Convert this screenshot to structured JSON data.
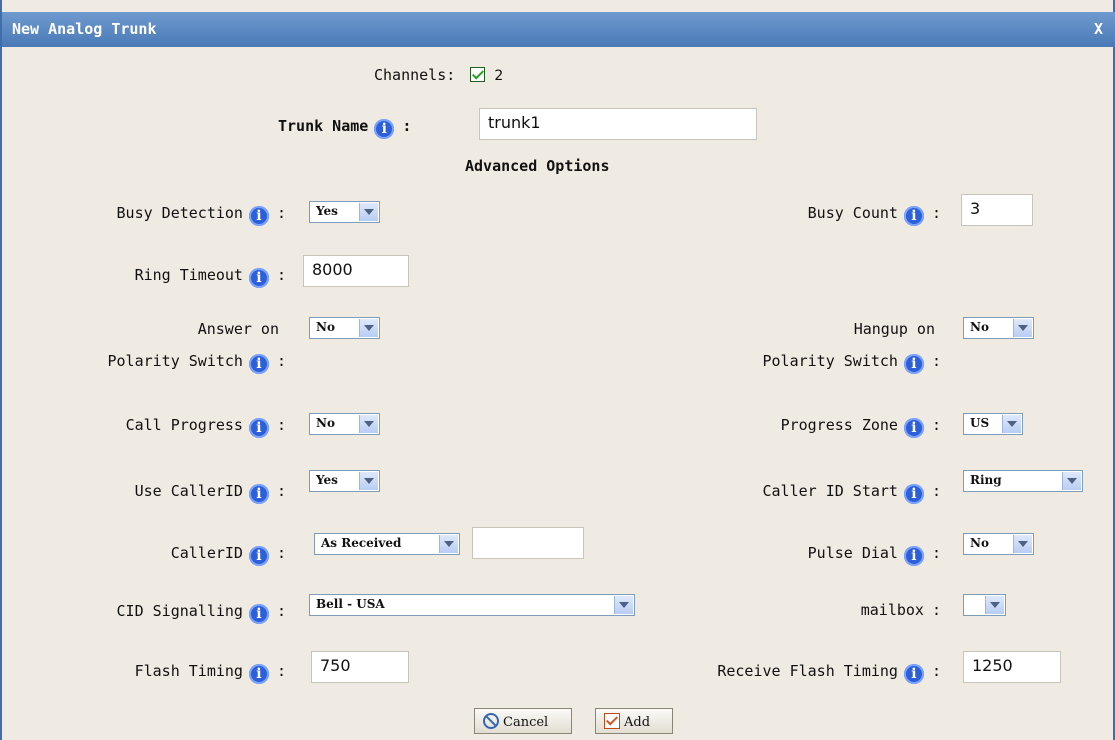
{
  "dialog": {
    "title": "New Analog Trunk",
    "close_label": "X"
  },
  "channels": {
    "label": "Channels:",
    "value": "2",
    "checked": true
  },
  "trunk_name": {
    "label": "Trunk Name",
    "value": "trunk1"
  },
  "section_title": "Advanced Options",
  "fields": {
    "busy_detection": {
      "label": "Busy Detection",
      "value": "Yes"
    },
    "busy_count": {
      "label": "Busy Count",
      "value": "3"
    },
    "ring_timeout": {
      "label": "Ring Timeout",
      "value": "8000"
    },
    "answer_on_polarity": {
      "label_line1": "Answer on",
      "label_line2": "Polarity Switch",
      "value": "No"
    },
    "hangup_on_polarity": {
      "label_line1": "Hangup on",
      "label_line2": "Polarity Switch",
      "value": "No"
    },
    "call_progress": {
      "label": "Call Progress",
      "value": "No"
    },
    "progress_zone": {
      "label": "Progress Zone",
      "value": "US"
    },
    "use_callerid": {
      "label": "Use CallerID",
      "value": "Yes"
    },
    "callerid_start": {
      "label": "Caller ID Start",
      "value": "Ring"
    },
    "callerid": {
      "label": "CallerID",
      "value": "As Received",
      "text_value": ""
    },
    "pulse_dial": {
      "label": "Pulse Dial",
      "value": "No"
    },
    "cid_signalling": {
      "label": "CID Signalling",
      "value": "Bell - USA"
    },
    "mailbox": {
      "label": "mailbox",
      "value": ""
    },
    "flash_timing": {
      "label": "Flash Timing",
      "value": "750"
    },
    "receive_flash_timing": {
      "label": "Receive Flash Timing",
      "value": "1250"
    }
  },
  "buttons": {
    "cancel": "Cancel",
    "add": "Add"
  }
}
